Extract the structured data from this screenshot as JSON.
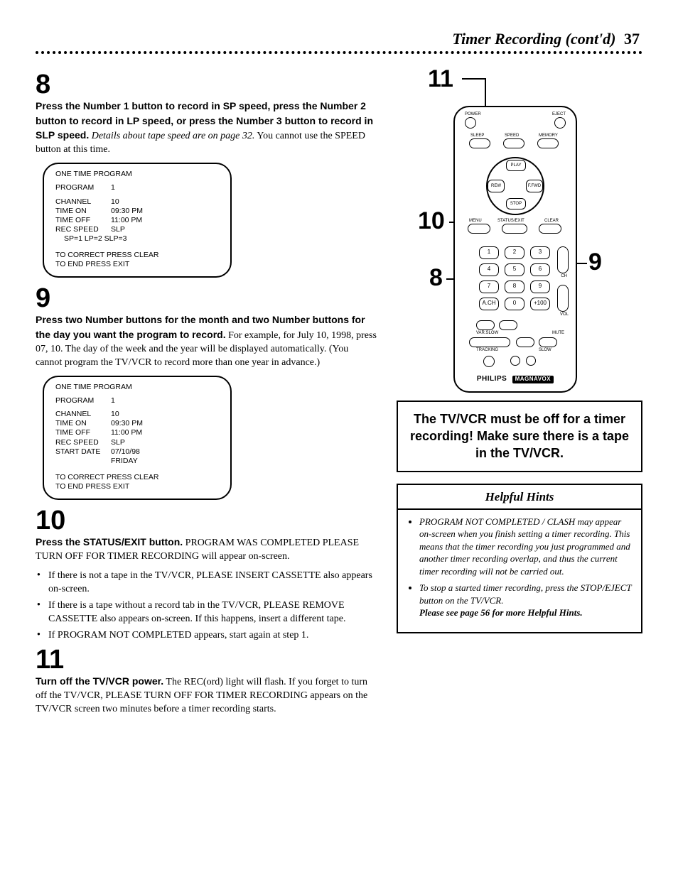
{
  "header": {
    "title": "Timer Recording (cont'd)",
    "page": "37"
  },
  "step8": {
    "num": "8",
    "lead": "Press the Number 1 button to record in SP speed, press the Number 2 button to record in LP speed, or press the Number 3 button to record in SLP speed.",
    "detail_ital": "Details about tape speed are on page 32.",
    "detail_rest": " You cannot use the SPEED button at this time."
  },
  "osd1": {
    "title": "ONE TIME PROGRAM",
    "program_k": "PROGRAM",
    "program_v": "1",
    "channel_k": "CHANNEL",
    "channel_v": "10",
    "on_k": "TIME ON",
    "on_v": "09:30 PM",
    "off_k": "TIME OFF",
    "off_v": "11:00 PM",
    "speed_k": "REC SPEED",
    "speed_v": "SLP",
    "speed_opts": "SP=1  LP=2  SLP=3",
    "foot1": "TO CORRECT PRESS CLEAR",
    "foot2": "TO END PRESS EXIT"
  },
  "step9": {
    "num": "9",
    "lead": "Press two Number buttons for the month and two Number buttons for the day you want the program to record.",
    "rest": " For example, for July 10, 1998, press 07, 10. The day of the week and the year will be displayed automatically. (You cannot program the TV/VCR to record more than one year in advance.)"
  },
  "osd2": {
    "title": "ONE TIME PROGRAM",
    "program_k": "PROGRAM",
    "program_v": "1",
    "channel_k": "CHANNEL",
    "channel_v": "10",
    "on_k": "TIME ON",
    "on_v": "09:30 PM",
    "off_k": "TIME OFF",
    "off_v": "11:00 PM",
    "speed_k": "REC SPEED",
    "speed_v": "SLP",
    "date_k": "START DATE",
    "date_v": "07/10/98",
    "dow": "FRIDAY",
    "foot1": "TO CORRECT PRESS CLEAR",
    "foot2": "TO END PRESS EXIT"
  },
  "step10": {
    "num": "10",
    "lead": "Press the STATUS/EXIT button.",
    "rest": " PROGRAM WAS COMPLETED PLEASE TURN OFF FOR TIMER RECORDING will appear on-screen.",
    "b1": "If there is not a tape in the TV/VCR, PLEASE INSERT CASSETTE also appears on-screen.",
    "b2": "If there is a tape without a record tab in the TV/VCR, PLEASE REMOVE CASSETTE also appears on-screen. If this happens, insert a different tape.",
    "b3": "If PROGRAM NOT COMPLETED appears, start again at step 1."
  },
  "step11": {
    "num": "11",
    "lead": "Turn off the TV/VCR power.",
    "rest": " The REC(ord) light will flash. If you forget to turn off the TV/VCR, PLEASE TURN OFF FOR TIMER RECORDING appears on the TV/VCR screen two minutes before a timer recording starts."
  },
  "figure": {
    "c11": "11",
    "c10": "10",
    "c9": "9",
    "c8": "8",
    "brand": "PHILIPS",
    "brand_box": "MAGNAVOX",
    "labels": {
      "power": "POWER",
      "eject": "EJECT",
      "sleep": "SLEEP",
      "speed": "SPEED",
      "memory": "MEMORY",
      "play": "PLAY",
      "rew": "REW",
      "ffwd": "F.FWD",
      "stop": "STOP",
      "menu": "MENU",
      "status": "STATUS/EXIT",
      "clear": "CLEAR",
      "ach": "A.CH",
      "zero": "0",
      "p100": "+100",
      "ch": "CH",
      "vol": "VOL",
      "tracking": "TRACKING",
      "slow": "SLOW",
      "varslow": "VAR.SLOW",
      "mute": "MUTE"
    }
  },
  "notice": "The TV/VCR must be off for a timer recording!  Make sure there is a tape in the TV/VCR.",
  "hints": {
    "title": "Helpful Hints",
    "i1": "PROGRAM NOT COMPLETED / CLASH may appear on-screen when you finish setting a timer recording. This means that the timer recording you just programmed and another timer recording overlap, and thus the current timer recording will not be carried out.",
    "i2": "To stop a started timer recording, press the STOP/EJECT button on the TV/VCR.",
    "seemore": "Please see page 56 for more Helpful Hints."
  }
}
